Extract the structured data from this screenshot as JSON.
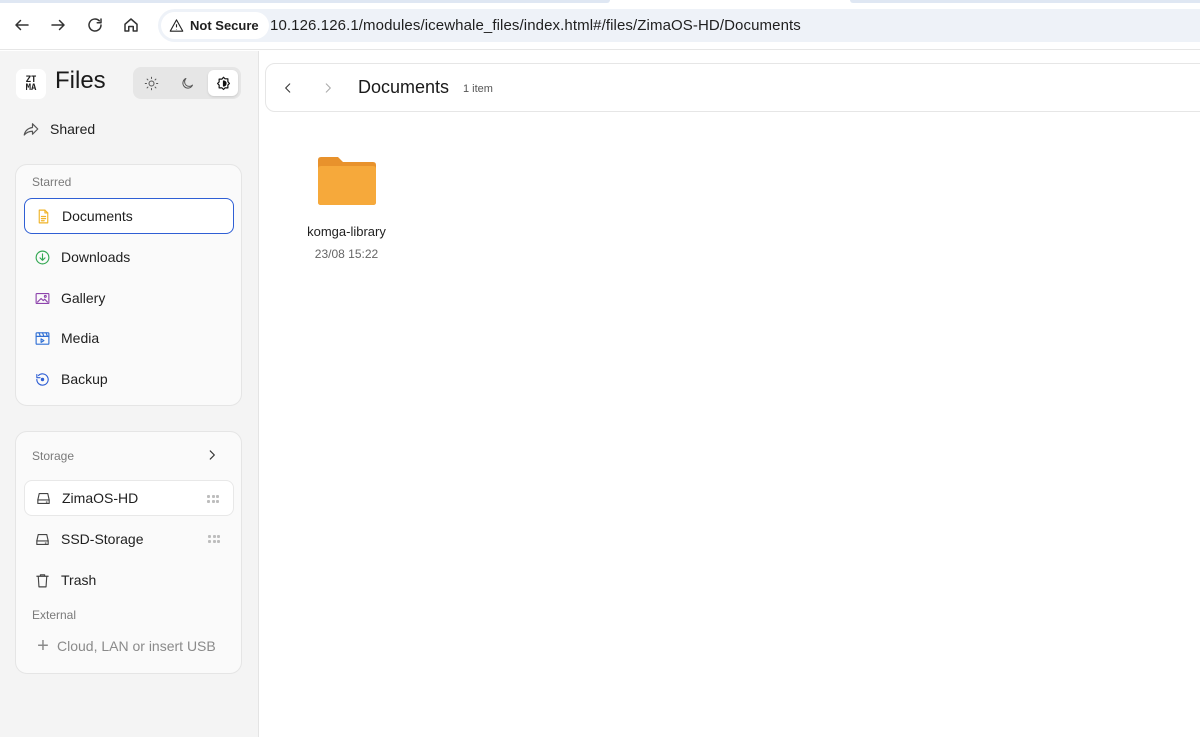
{
  "browser": {
    "security_label": "Not Secure",
    "url": "10.126.126.1/modules/icewhale_files/index.html#/files/ZimaOS-HD/Documents"
  },
  "app": {
    "logo_text_top": "ZT",
    "logo_text_bottom": "MA",
    "title": "Files"
  },
  "sidebar": {
    "shared_label": "Shared",
    "starred_label": "Starred",
    "starred_items": [
      {
        "label": "Documents",
        "icon": "document-icon",
        "color": "#f0b429"
      },
      {
        "label": "Downloads",
        "icon": "download-icon",
        "color": "#34a853"
      },
      {
        "label": "Gallery",
        "icon": "image-icon",
        "color": "#8e44ad"
      },
      {
        "label": "Media",
        "icon": "video-icon",
        "color": "#2f6fd4"
      },
      {
        "label": "Backup",
        "icon": "backup-icon",
        "color": "#2f5fd4"
      }
    ],
    "storage_label": "Storage",
    "storage_items": [
      {
        "label": "ZimaOS-HD",
        "icon": "drive-icon"
      },
      {
        "label": "SSD-Storage",
        "icon": "drive-icon"
      },
      {
        "label": "Trash",
        "icon": "trash-icon"
      }
    ],
    "external_label": "External",
    "add_external_label": "Cloud, LAN or insert USB"
  },
  "main": {
    "current_folder": "Documents",
    "item_count": "1 item",
    "files": [
      {
        "name": "komga-library",
        "date": "23/08 15:22",
        "type": "folder",
        "color": "#f6a93b"
      }
    ]
  },
  "colors": {
    "accent": "#2f5fd4",
    "folder": "#f6a93b"
  }
}
